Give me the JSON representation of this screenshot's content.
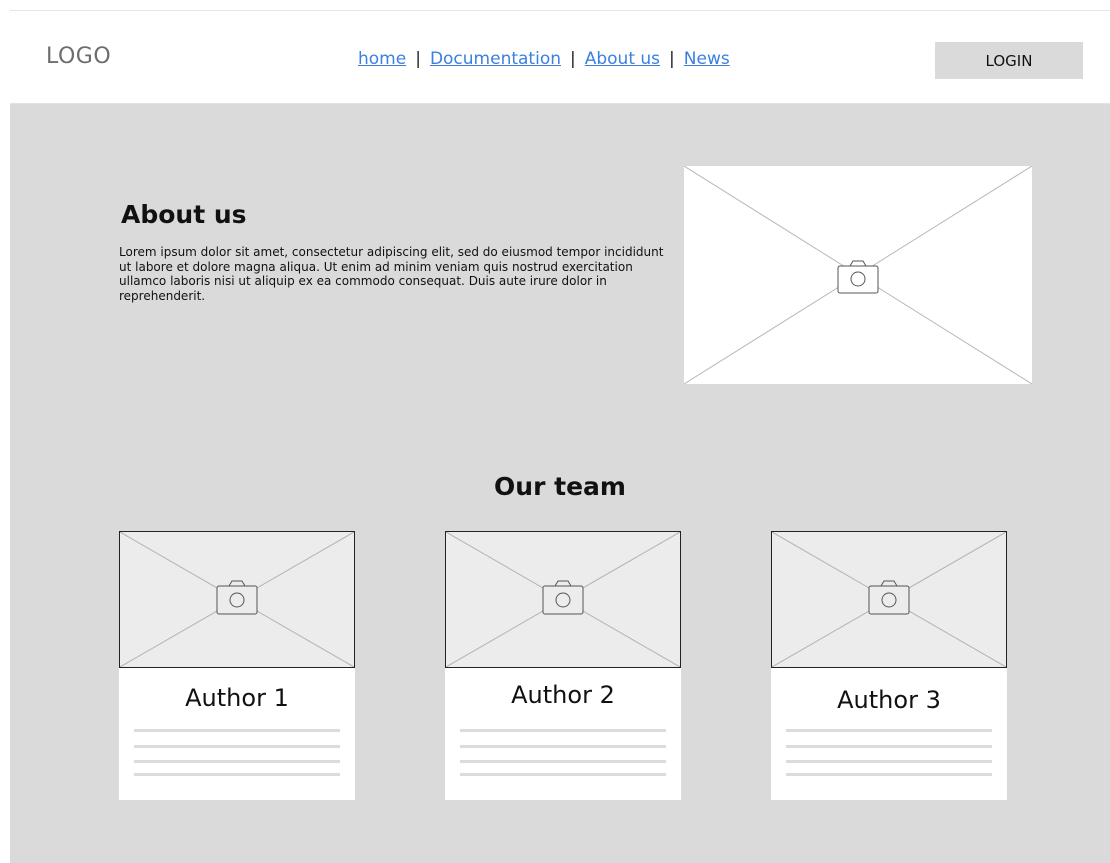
{
  "header": {
    "logo": "LOGO",
    "nav": [
      {
        "label": "home"
      },
      {
        "label": "Documentation"
      },
      {
        "label": "About us"
      },
      {
        "label": "News"
      }
    ],
    "separator": "|",
    "login_label": "LOGIN"
  },
  "about": {
    "title": "About us",
    "text": "Lorem ipsum dolor sit amet, consectetur adipiscing elit, sed do eiusmod tempor incididunt ut labore et dolore magna aliqua. Ut enim ad minim veniam quis nostrud exercitation ullamco laboris nisi ut aliquip ex ea commodo consequat. Duis aute irure dolor in reprehenderit.",
    "image_icon": "camera-icon"
  },
  "team": {
    "title": "Our team",
    "members": [
      {
        "name": "Author 1",
        "image_icon": "camera-icon"
      },
      {
        "name": "Author 2",
        "image_icon": "camera-icon"
      },
      {
        "name": "Author 3",
        "image_icon": "camera-icon"
      }
    ]
  },
  "colors": {
    "background": "#dadada",
    "header_bg": "#ffffff",
    "link": "#3b7fe0",
    "button_bg": "#dadada",
    "thumb_bg": "#ececec"
  }
}
